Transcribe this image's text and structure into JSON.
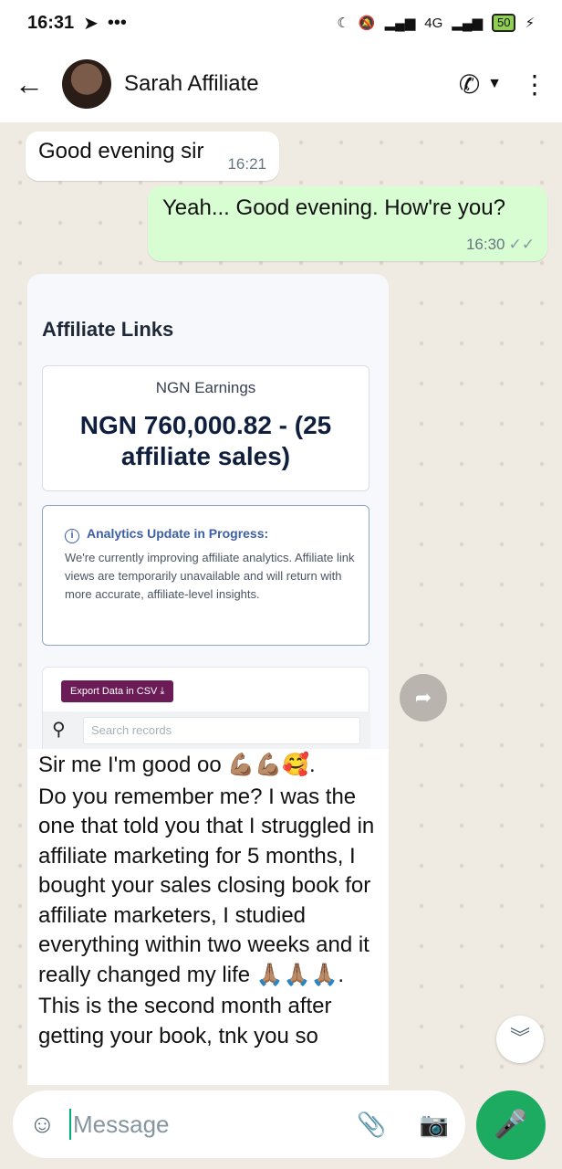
{
  "status_bar": {
    "time": "16:31",
    "left_icons": [
      "telegram-icon",
      "more-dots-icon"
    ],
    "network": "4G",
    "battery": "50"
  },
  "header": {
    "contact_name": "Sarah Affiliate"
  },
  "messages": [
    {
      "direction": "in",
      "text": "Good evening sir",
      "time": "16:21"
    },
    {
      "direction": "out",
      "text": "Yeah... Good evening. How're you?",
      "time": "16:30",
      "status": "read"
    }
  ],
  "screenshot_card": {
    "title": "Affiliate Links",
    "earnings_label": "NGN Earnings",
    "earnings_value": "NGN 760,000.82 - (25 affiliate sales)",
    "notice_title": "Analytics Update in Progress:",
    "notice_body": "We're currently improving affiliate analytics. Affiliate link views are temporarily unavailable and will return with more accurate, affiliate-level insights.",
    "export_button": "Export Data in CSV",
    "search_placeholder": "Search records"
  },
  "long_message": {
    "line1": "Sir me I'm good oo 💪🏽💪🏽🥰.",
    "body": "Do you remember me? I was the one that told you that I struggled in affiliate marketing for 5 months, I bought your sales closing book for affiliate marketers, I studied everything within two weeks and it really changed my life 🙏🏽🙏🏽🙏🏽.",
    "line_last": "This is the second month after getting your book, tnk you so"
  },
  "input": {
    "placeholder": "Message"
  }
}
